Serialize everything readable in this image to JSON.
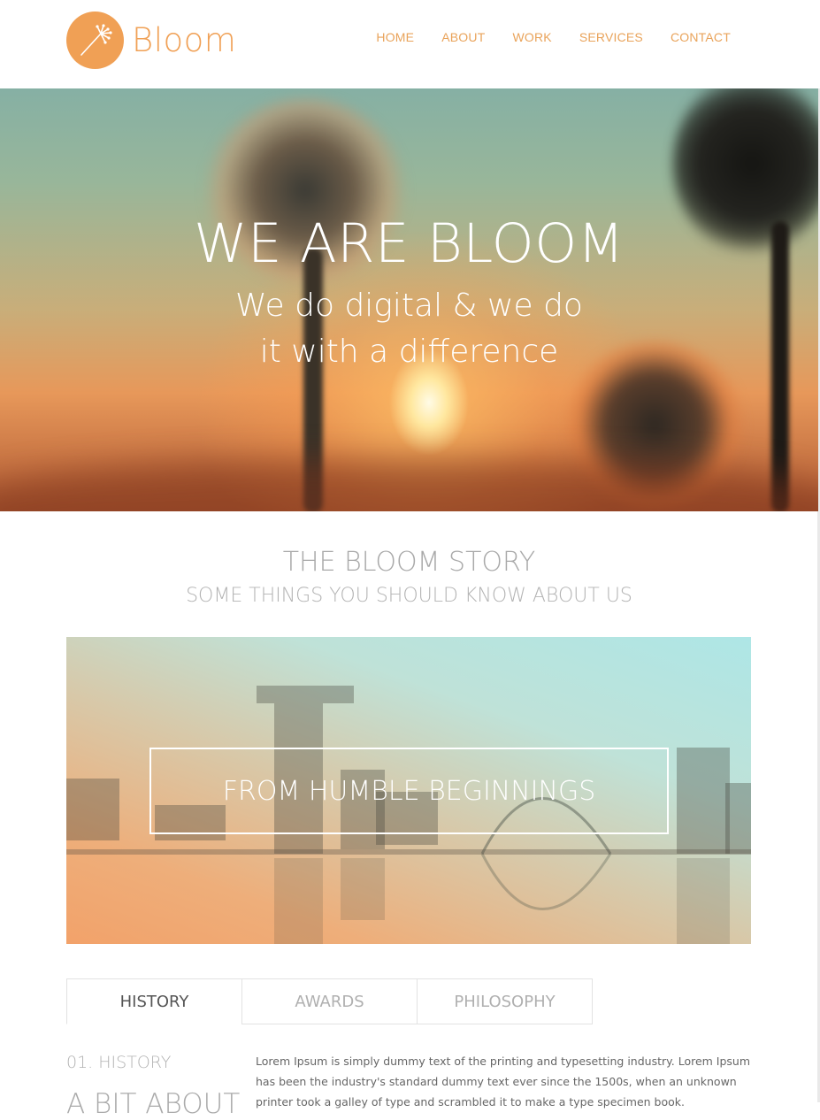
{
  "brand": {
    "name": "Bloom",
    "logo_icon": "dandelion-icon",
    "accent": "#f0a055"
  },
  "nav": {
    "items": [
      "HOME",
      "ABOUT",
      "WORK",
      "SERVICES",
      "CONTACT"
    ]
  },
  "hero": {
    "title": "WE ARE BLOOM",
    "subtitle_line1": "We do digital & we do",
    "subtitle_line2": "it with a difference"
  },
  "story": {
    "title": "THE BLOOM STORY",
    "subtitle": "SOME THINGS YOU SHOULD KNOW ABOUT US",
    "banner_label": "FROM HUMBLE BEGINNINGS"
  },
  "tabs": [
    "HISTORY",
    "AWARDS",
    "PHILOSOPHY"
  ],
  "active_tab": "HISTORY",
  "content": {
    "section_number": "01. HISTORY",
    "section_heading": "A BIT ABOUT",
    "paragraph": "Lorem Ipsum is simply dummy text of the printing and typesetting industry. Lorem Ipsum has been the industry's standard dummy text ever since the 1500s, when an unknown printer took a galley of type and scrambled it to make a type specimen book."
  }
}
